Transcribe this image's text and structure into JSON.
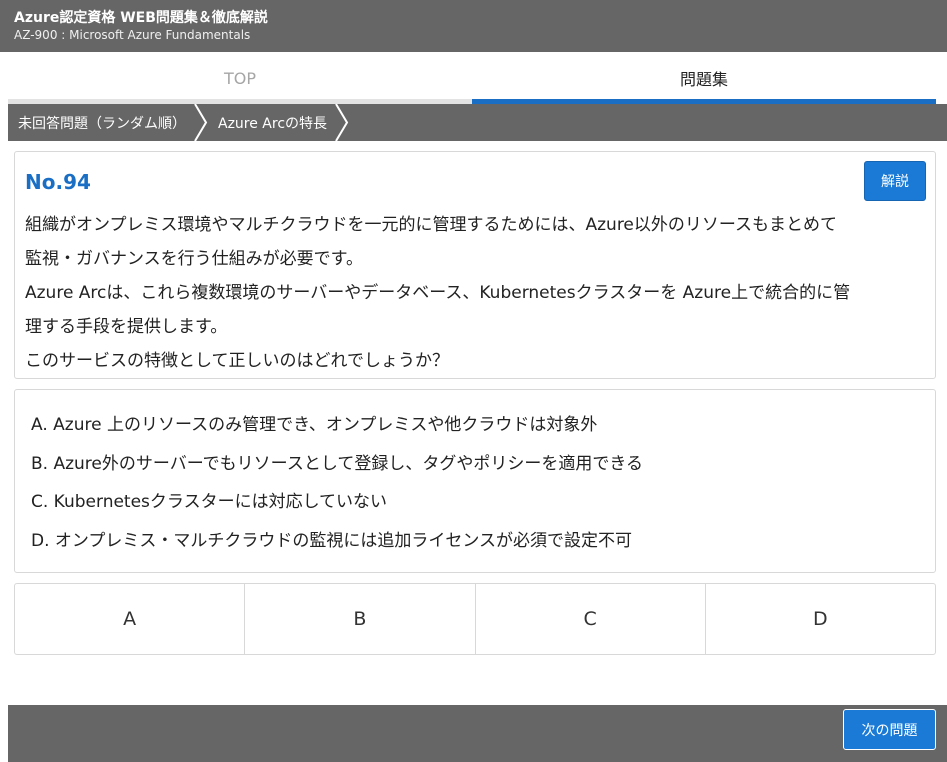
{
  "header": {
    "title": "Azure認定資格 WEB問題集＆徹底解説",
    "subtitle": "AZ-900 : Microsoft Azure Fundamentals"
  },
  "tabs": [
    {
      "label": "TOP",
      "active": false
    },
    {
      "label": "問題集",
      "active": true
    }
  ],
  "breadcrumb": [
    {
      "label": "未回答問題（ランダム順）"
    },
    {
      "label": "Azure Arcの特長"
    }
  ],
  "question": {
    "number": "No.94",
    "explain_label": "解説",
    "lines": [
      "組織がオンプレミス環境やマルチクラウドを一元的に管理するためには、Azure以外のリソースもまとめて",
      "監視・ガバナンスを行う仕組みが必要です。",
      "Azure Arcは、これら複数環境のサーバーやデータベース、Kubernetesクラスターを Azure上で統合的に管",
      "理する手段を提供します。",
      "このサービスの特徴として正しいのはどれでしょうか？"
    ]
  },
  "choices": [
    "A. Azure 上のリソースのみ管理でき、オンプレミスや他クラウドは対象外",
    "B. Azure外のサーバーでもリソースとして登録し、タグやポリシーを適用できる",
    "C. Kubernetesクラスターには対応していない",
    "D. オンプレミス・マルチクラウドの監視には追加ライセンスが必須で設定不可"
  ],
  "answers": [
    "A",
    "B",
    "C",
    "D"
  ],
  "footer": {
    "next_label": "次の問題"
  },
  "colors": {
    "header_bg": "#666666",
    "accent_blue": "#1a7ad6",
    "question_number": "#1a6fc4"
  }
}
